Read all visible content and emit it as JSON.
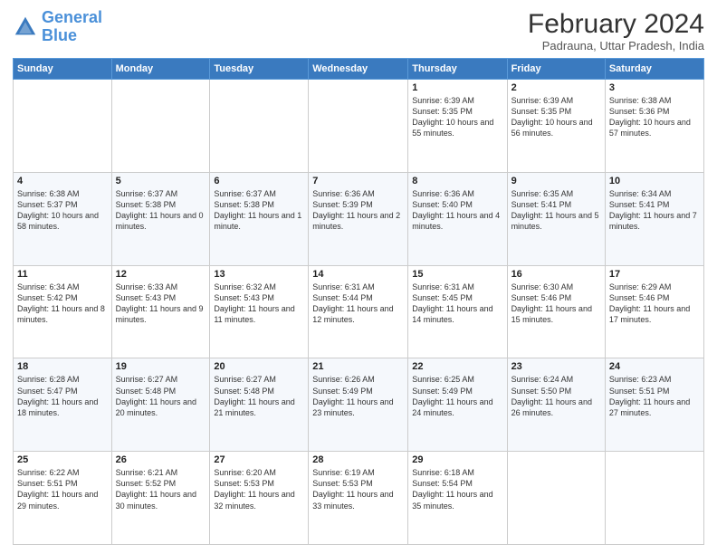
{
  "header": {
    "logo_line1": "General",
    "logo_line2": "Blue",
    "title": "February 2024",
    "subtitle": "Padrauna, Uttar Pradesh, India"
  },
  "weekdays": [
    "Sunday",
    "Monday",
    "Tuesday",
    "Wednesday",
    "Thursday",
    "Friday",
    "Saturday"
  ],
  "weeks": [
    [
      {
        "day": "",
        "info": ""
      },
      {
        "day": "",
        "info": ""
      },
      {
        "day": "",
        "info": ""
      },
      {
        "day": "",
        "info": ""
      },
      {
        "day": "1",
        "info": "Sunrise: 6:39 AM\nSunset: 5:35 PM\nDaylight: 10 hours and 55 minutes."
      },
      {
        "day": "2",
        "info": "Sunrise: 6:39 AM\nSunset: 5:35 PM\nDaylight: 10 hours and 56 minutes."
      },
      {
        "day": "3",
        "info": "Sunrise: 6:38 AM\nSunset: 5:36 PM\nDaylight: 10 hours and 57 minutes."
      }
    ],
    [
      {
        "day": "4",
        "info": "Sunrise: 6:38 AM\nSunset: 5:37 PM\nDaylight: 10 hours and 58 minutes."
      },
      {
        "day": "5",
        "info": "Sunrise: 6:37 AM\nSunset: 5:38 PM\nDaylight: 11 hours and 0 minutes."
      },
      {
        "day": "6",
        "info": "Sunrise: 6:37 AM\nSunset: 5:38 PM\nDaylight: 11 hours and 1 minute."
      },
      {
        "day": "7",
        "info": "Sunrise: 6:36 AM\nSunset: 5:39 PM\nDaylight: 11 hours and 2 minutes."
      },
      {
        "day": "8",
        "info": "Sunrise: 6:36 AM\nSunset: 5:40 PM\nDaylight: 11 hours and 4 minutes."
      },
      {
        "day": "9",
        "info": "Sunrise: 6:35 AM\nSunset: 5:41 PM\nDaylight: 11 hours and 5 minutes."
      },
      {
        "day": "10",
        "info": "Sunrise: 6:34 AM\nSunset: 5:41 PM\nDaylight: 11 hours and 7 minutes."
      }
    ],
    [
      {
        "day": "11",
        "info": "Sunrise: 6:34 AM\nSunset: 5:42 PM\nDaylight: 11 hours and 8 minutes."
      },
      {
        "day": "12",
        "info": "Sunrise: 6:33 AM\nSunset: 5:43 PM\nDaylight: 11 hours and 9 minutes."
      },
      {
        "day": "13",
        "info": "Sunrise: 6:32 AM\nSunset: 5:43 PM\nDaylight: 11 hours and 11 minutes."
      },
      {
        "day": "14",
        "info": "Sunrise: 6:31 AM\nSunset: 5:44 PM\nDaylight: 11 hours and 12 minutes."
      },
      {
        "day": "15",
        "info": "Sunrise: 6:31 AM\nSunset: 5:45 PM\nDaylight: 11 hours and 14 minutes."
      },
      {
        "day": "16",
        "info": "Sunrise: 6:30 AM\nSunset: 5:46 PM\nDaylight: 11 hours and 15 minutes."
      },
      {
        "day": "17",
        "info": "Sunrise: 6:29 AM\nSunset: 5:46 PM\nDaylight: 11 hours and 17 minutes."
      }
    ],
    [
      {
        "day": "18",
        "info": "Sunrise: 6:28 AM\nSunset: 5:47 PM\nDaylight: 11 hours and 18 minutes."
      },
      {
        "day": "19",
        "info": "Sunrise: 6:27 AM\nSunset: 5:48 PM\nDaylight: 11 hours and 20 minutes."
      },
      {
        "day": "20",
        "info": "Sunrise: 6:27 AM\nSunset: 5:48 PM\nDaylight: 11 hours and 21 minutes."
      },
      {
        "day": "21",
        "info": "Sunrise: 6:26 AM\nSunset: 5:49 PM\nDaylight: 11 hours and 23 minutes."
      },
      {
        "day": "22",
        "info": "Sunrise: 6:25 AM\nSunset: 5:49 PM\nDaylight: 11 hours and 24 minutes."
      },
      {
        "day": "23",
        "info": "Sunrise: 6:24 AM\nSunset: 5:50 PM\nDaylight: 11 hours and 26 minutes."
      },
      {
        "day": "24",
        "info": "Sunrise: 6:23 AM\nSunset: 5:51 PM\nDaylight: 11 hours and 27 minutes."
      }
    ],
    [
      {
        "day": "25",
        "info": "Sunrise: 6:22 AM\nSunset: 5:51 PM\nDaylight: 11 hours and 29 minutes."
      },
      {
        "day": "26",
        "info": "Sunrise: 6:21 AM\nSunset: 5:52 PM\nDaylight: 11 hours and 30 minutes."
      },
      {
        "day": "27",
        "info": "Sunrise: 6:20 AM\nSunset: 5:53 PM\nDaylight: 11 hours and 32 minutes."
      },
      {
        "day": "28",
        "info": "Sunrise: 6:19 AM\nSunset: 5:53 PM\nDaylight: 11 hours and 33 minutes."
      },
      {
        "day": "29",
        "info": "Sunrise: 6:18 AM\nSunset: 5:54 PM\nDaylight: 11 hours and 35 minutes."
      },
      {
        "day": "",
        "info": ""
      },
      {
        "day": "",
        "info": ""
      }
    ]
  ]
}
